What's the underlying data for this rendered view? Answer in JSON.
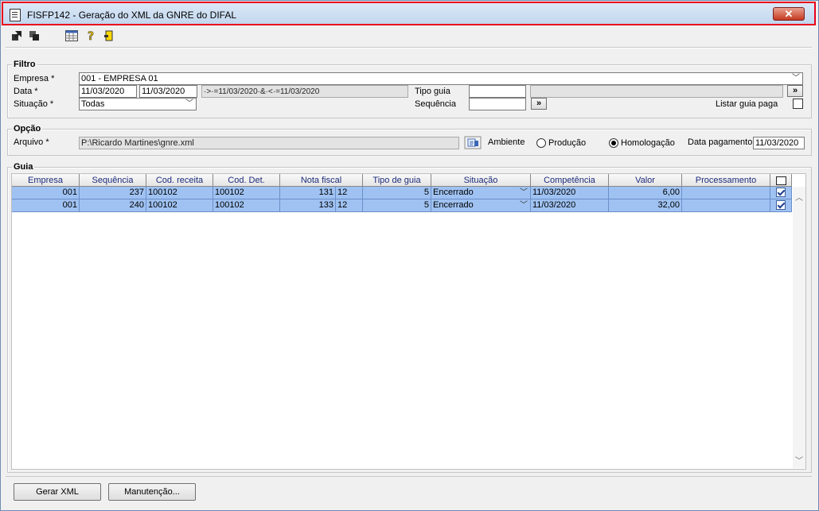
{
  "window": {
    "title": "FISFP142 - Geração do XML da GNRE do DIFAL",
    "close_label": "✕"
  },
  "toolbar": {
    "icons": [
      "export-icon",
      "import-icon",
      "calendar-grid-icon",
      "help-icon",
      "exit-icon"
    ]
  },
  "filtro": {
    "label": "Filtro",
    "empresa_label": "Empresa *",
    "empresa_value": "001 - EMPRESA 01",
    "data_label": "Data *",
    "data_from": "11/03/2020",
    "data_to": "11/03/2020",
    "data_expr": "·>·=11/03/2020·&·<·=11/03/2020",
    "tipo_guia_label": "Tipo guia",
    "tipo_guia_value": "",
    "tipo_guia_desc": "",
    "situacao_label": "Situação *",
    "situacao_value": "Todas",
    "sequencia_label": "Sequência",
    "sequencia_value": "",
    "listar_guia_paga_label": "Listar guia paga",
    "more_label": "»"
  },
  "opcao": {
    "label": "Opção",
    "arquivo_label": "Arquivo *",
    "arquivo_value": "P:\\Ricardo Martines\\gnre.xml",
    "ambiente_label": "Ambiente",
    "producao_label": "Produção",
    "homologacao_label": "Homologação",
    "data_pagamento_label": "Data pagamento",
    "data_pagamento_value": "11/03/2020"
  },
  "guia": {
    "label": "Guia",
    "columns": [
      "Empresa",
      "Sequência",
      "Cod. receita",
      "Cod. Det.",
      "Nota fiscal",
      "Tipo de guia",
      "Situação",
      "Competência",
      "Valor",
      "Processamento"
    ],
    "rows": [
      {
        "empresa": "001",
        "sequencia": "237",
        "cod_receita": "100102",
        "cod_det": "100102",
        "nota_fiscal": "131",
        "serie": "12",
        "tipo_guia": "5",
        "situacao": "Encerrado",
        "competencia": "11/03/2020",
        "valor": "6,00",
        "processamento": "",
        "checked": true
      },
      {
        "empresa": "001",
        "sequencia": "240",
        "cod_receita": "100102",
        "cod_det": "100102",
        "nota_fiscal": "133",
        "serie": "12",
        "tipo_guia": "5",
        "situacao": "Encerrado",
        "competencia": "11/03/2020",
        "valor": "32,00",
        "processamento": "",
        "checked": true
      }
    ]
  },
  "buttons": {
    "gerar_xml": "Gerar XML",
    "manutencao": "Manutenção..."
  }
}
